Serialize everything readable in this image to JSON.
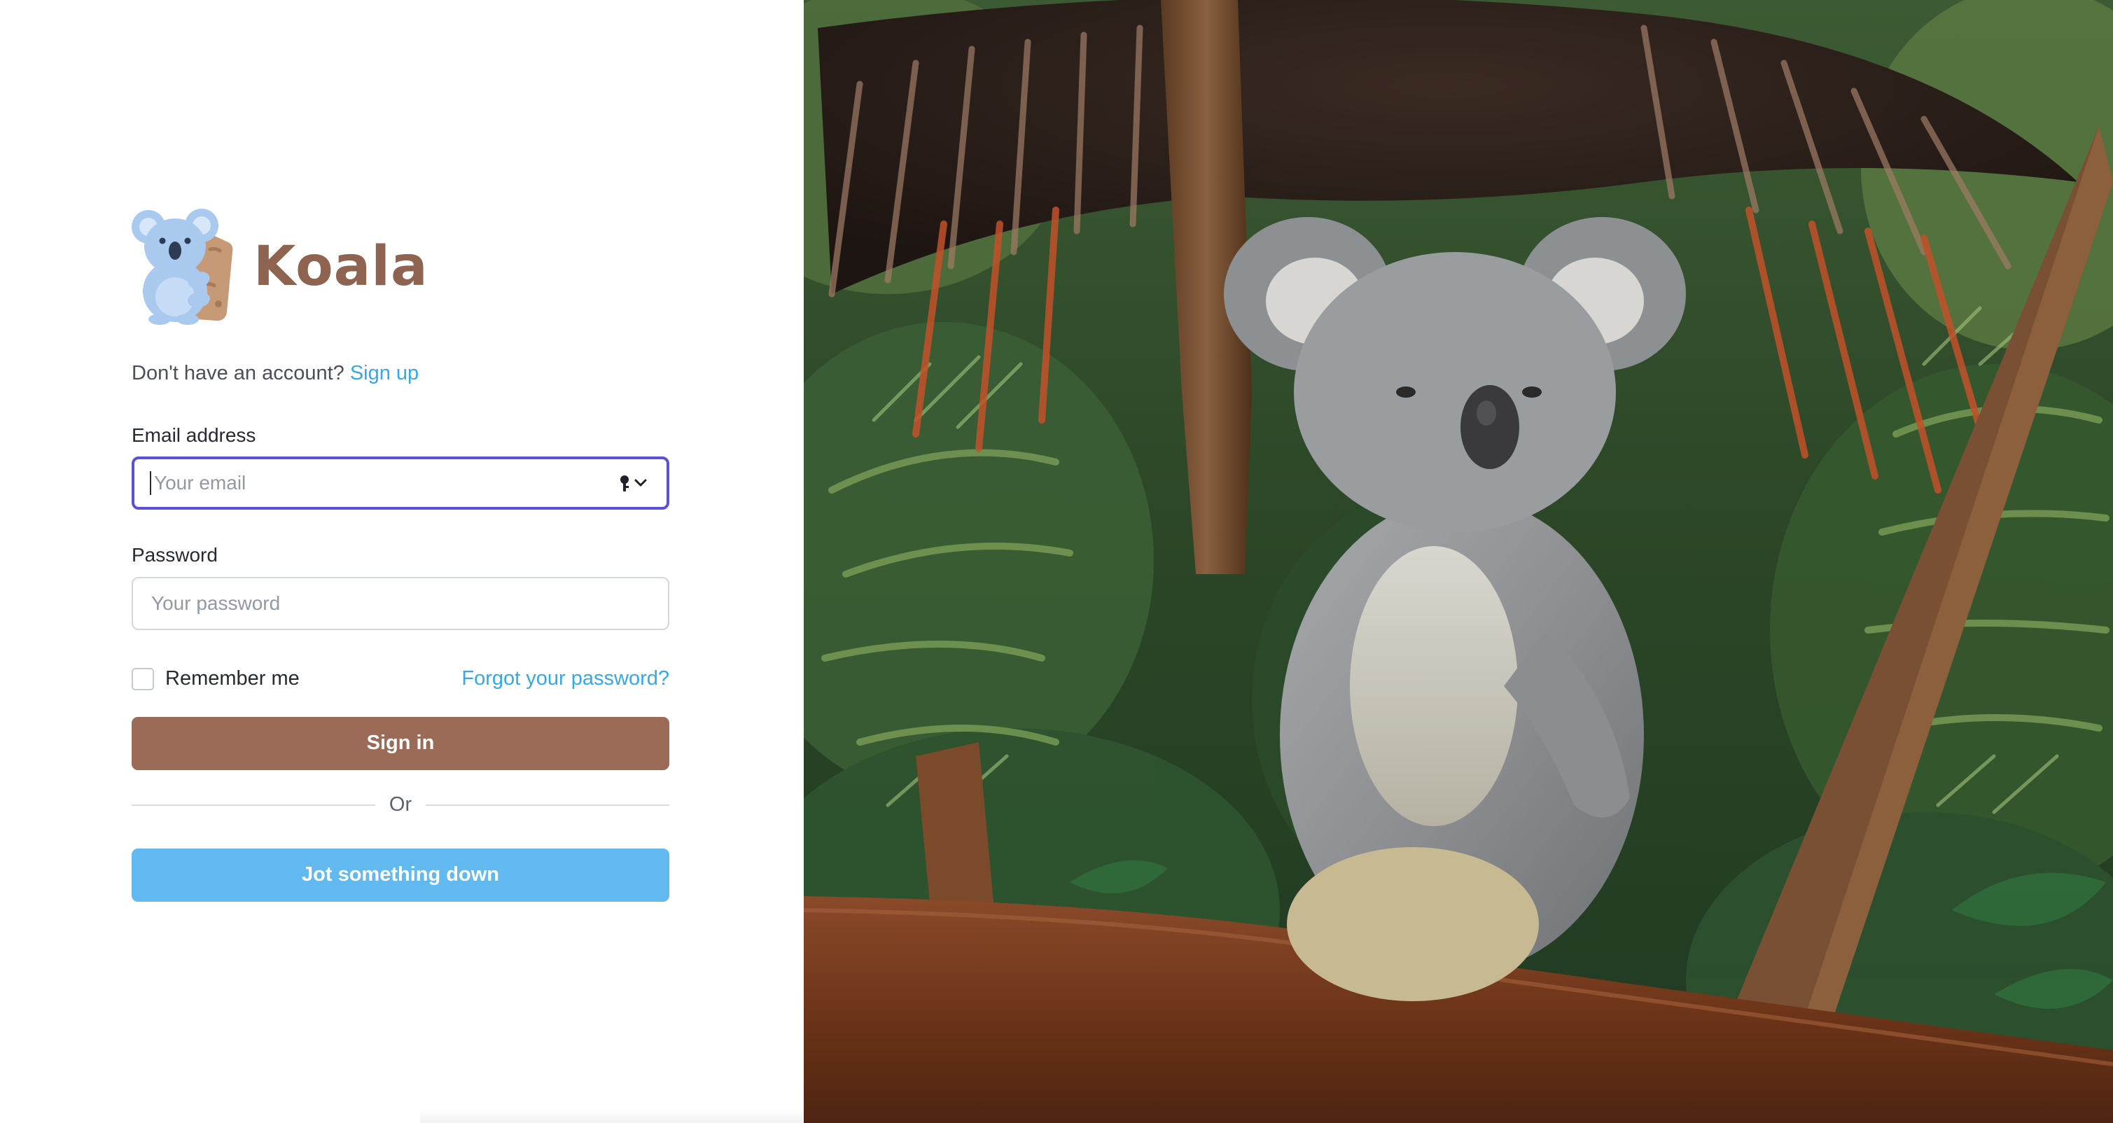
{
  "brand": {
    "name": "Koala",
    "colors": {
      "brand_brown": "#8e6350",
      "koala_blue": "#a9c9ef"
    }
  },
  "signup": {
    "prompt": "Don't have an account?",
    "link_label": "Sign up"
  },
  "email": {
    "label": "Email address",
    "placeholder": "Your email",
    "value": "",
    "icon": "key-icon"
  },
  "password": {
    "label": "Password",
    "placeholder": "Your password",
    "value": ""
  },
  "remember": {
    "label": "Remember me",
    "checked": false
  },
  "forgot": {
    "label": "Forgot your password?"
  },
  "buttons": {
    "sign_in": "Sign in",
    "divider": "Or",
    "jot": "Jot something down"
  },
  "colors": {
    "focus_ring": "#5b50d6",
    "link": "#35a9e6",
    "sign_in_button": "#9b6b58",
    "jot_button": "#61b9f0"
  },
  "hero": {
    "subject": "koala-in-tree-photo"
  }
}
